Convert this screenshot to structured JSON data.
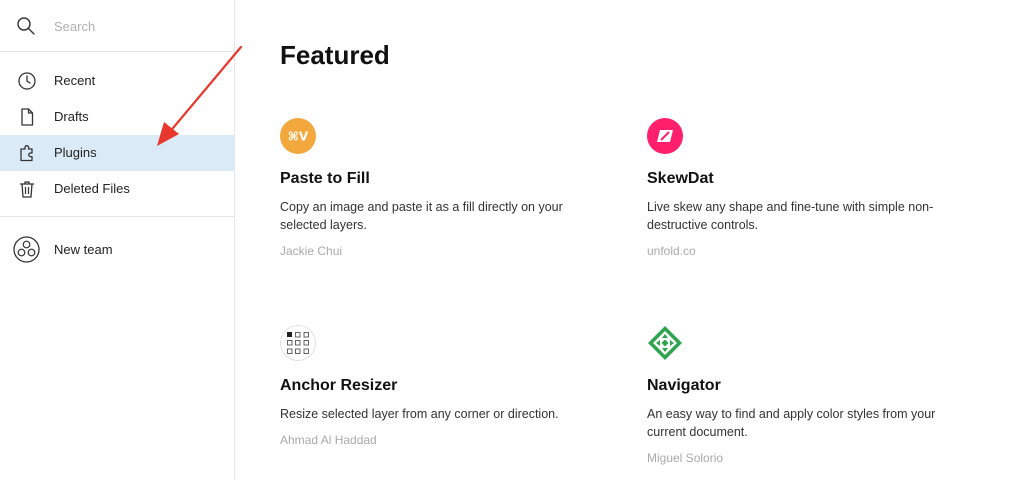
{
  "search": {
    "placeholder": "Search",
    "value": ""
  },
  "nav": {
    "items": [
      {
        "label": "Recent",
        "icon": "clock-icon"
      },
      {
        "label": "Drafts",
        "icon": "file-icon"
      },
      {
        "label": "Plugins",
        "icon": "plugin-icon",
        "active": true
      },
      {
        "label": "Deleted Files",
        "icon": "trash-icon"
      }
    ],
    "team": {
      "label": "New team",
      "icon": "team-icon"
    }
  },
  "main": {
    "title": "Featured",
    "plugins": [
      {
        "name": "Paste to Fill",
        "description": "Copy an image and paste it as a fill directly on your selected layers.",
        "author": "Jackie Chui",
        "logo_text": "⌘V",
        "logo_color": "#f2a83c"
      },
      {
        "name": "SkewDat",
        "description": "Live skew any shape and fine-tune with simple non-destructive controls.",
        "author": "unfold.co",
        "logo_color": "#ff1f6b"
      },
      {
        "name": "Anchor Resizer",
        "description": "Resize selected layer from any corner or direction.",
        "author": "Ahmad Al Haddad"
      },
      {
        "name": "Navigator",
        "description": "An easy way to find and apply color styles from your current document.",
        "author": "Miguel Solorio",
        "logo_color": "#2ea44f"
      }
    ]
  },
  "colors": {
    "active_nav_bg": "#daeaf7",
    "annotation_arrow": "#e8372c"
  }
}
